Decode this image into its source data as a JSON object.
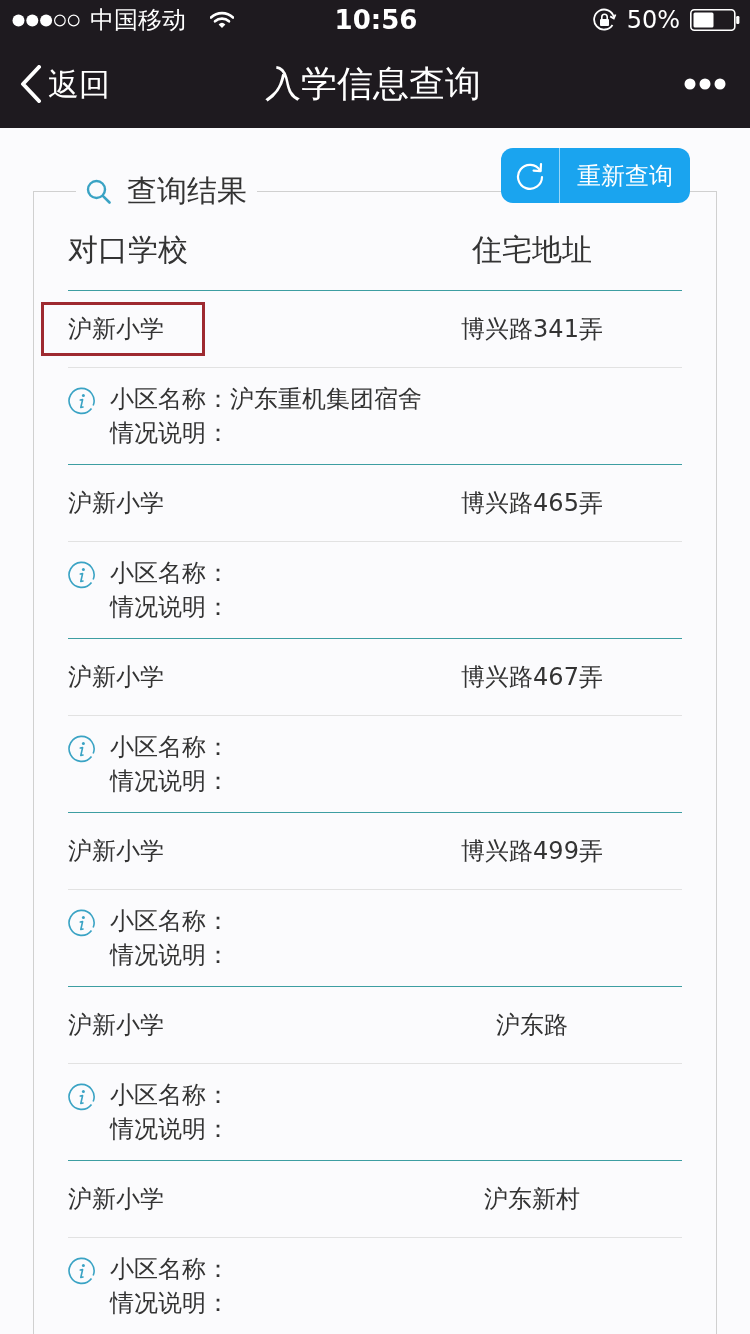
{
  "status_bar": {
    "carrier": "中国移动",
    "time": "10:56",
    "battery": "50%"
  },
  "nav_bar": {
    "back_label": "返回",
    "title": "入学信息查询"
  },
  "results": {
    "legend": "查询结果",
    "requery_button": "重新查询",
    "columns": [
      "对口学校",
      "住宅地址"
    ],
    "rows": [
      {
        "school": "沪新小学",
        "address": "博兴路341弄",
        "highlighted": true,
        "community_line": "小区名称：沪东重机集团宿舍",
        "note_line": "情况说明："
      },
      {
        "school": "沪新小学",
        "address": "博兴路465弄",
        "highlighted": false,
        "community_line": "小区名称：",
        "note_line": "情况说明："
      },
      {
        "school": "沪新小学",
        "address": "博兴路467弄",
        "highlighted": false,
        "community_line": "小区名称：",
        "note_line": "情况说明："
      },
      {
        "school": "沪新小学",
        "address": "博兴路499弄",
        "highlighted": false,
        "community_line": "小区名称：",
        "note_line": "情况说明："
      },
      {
        "school": "沪新小学",
        "address": "沪东路",
        "highlighted": false,
        "community_line": "小区名称：",
        "note_line": "情况说明："
      },
      {
        "school": "沪新小学",
        "address": "沪东新村",
        "highlighted": false,
        "community_line": "小区名称：",
        "note_line": "情况说明："
      }
    ]
  }
}
